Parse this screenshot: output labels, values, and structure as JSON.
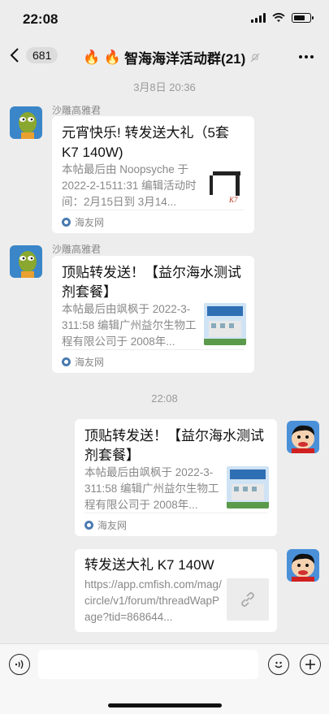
{
  "status": {
    "time": "22:08"
  },
  "nav": {
    "back_count": "681",
    "title": "智海海洋活动群(21)",
    "fire_icons": "🔥 🔥"
  },
  "timestamps": {
    "t1": "3月8日 20:36",
    "t2": "22:08"
  },
  "messages": [
    {
      "sender": "沙雕高雅君",
      "title": "元宵快乐! 转发送大礼（5套K7  140W)",
      "desc": "本帖最后由 Noopsyche 于 2022-2-1511:31 编辑活动时间：2月15日到 3月14...",
      "source": "海友网"
    },
    {
      "sender": "沙雕高雅君",
      "title": "顶贴转发送！【益尔海水测试剂套餐】",
      "desc": "本帖最后由飒枫于 2022-3-311:58 编辑广州益尔生物工程有限公司于 2008年...",
      "source": "海友网"
    },
    {
      "title": "顶贴转发送！【益尔海水测试剂套餐】",
      "desc": "本帖最后由飒枫于 2022-3-311:58 编辑广州益尔生物工程有限公司于 2008年...",
      "source": "海友网"
    },
    {
      "title": "转发送大礼 K7 140W",
      "desc": "https://app.cmfish.com/mag/circle/v1/forum/threadWapPage?tid=868644..."
    }
  ],
  "colors": {
    "background": "#ededed",
    "bubble": "#ffffff",
    "meta_text": "#888888"
  },
  "icons": [
    "back-chevron-icon",
    "mute-icon",
    "more-icon",
    "voice-icon",
    "emoji-icon",
    "plus-icon",
    "link-icon"
  ]
}
